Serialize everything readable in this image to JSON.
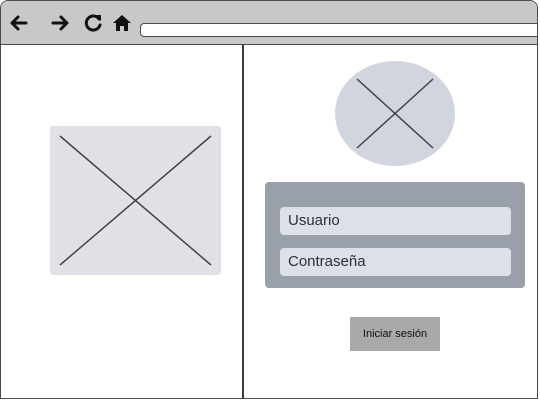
{
  "browser": {
    "icons": {
      "back": "arrow-left",
      "forward": "arrow-right",
      "reload": "refresh",
      "home": "home"
    },
    "url": ""
  },
  "login": {
    "username_placeholder": "Usuario",
    "password_placeholder": "Contraseña",
    "submit_label": "Iniciar sesión"
  },
  "colors": {
    "toolbar": "#c7c8ca",
    "panel": "#9aa0aa",
    "field": "#dde0e6",
    "placeholder": "#dfe1e6",
    "button": "#a8a9ab"
  }
}
